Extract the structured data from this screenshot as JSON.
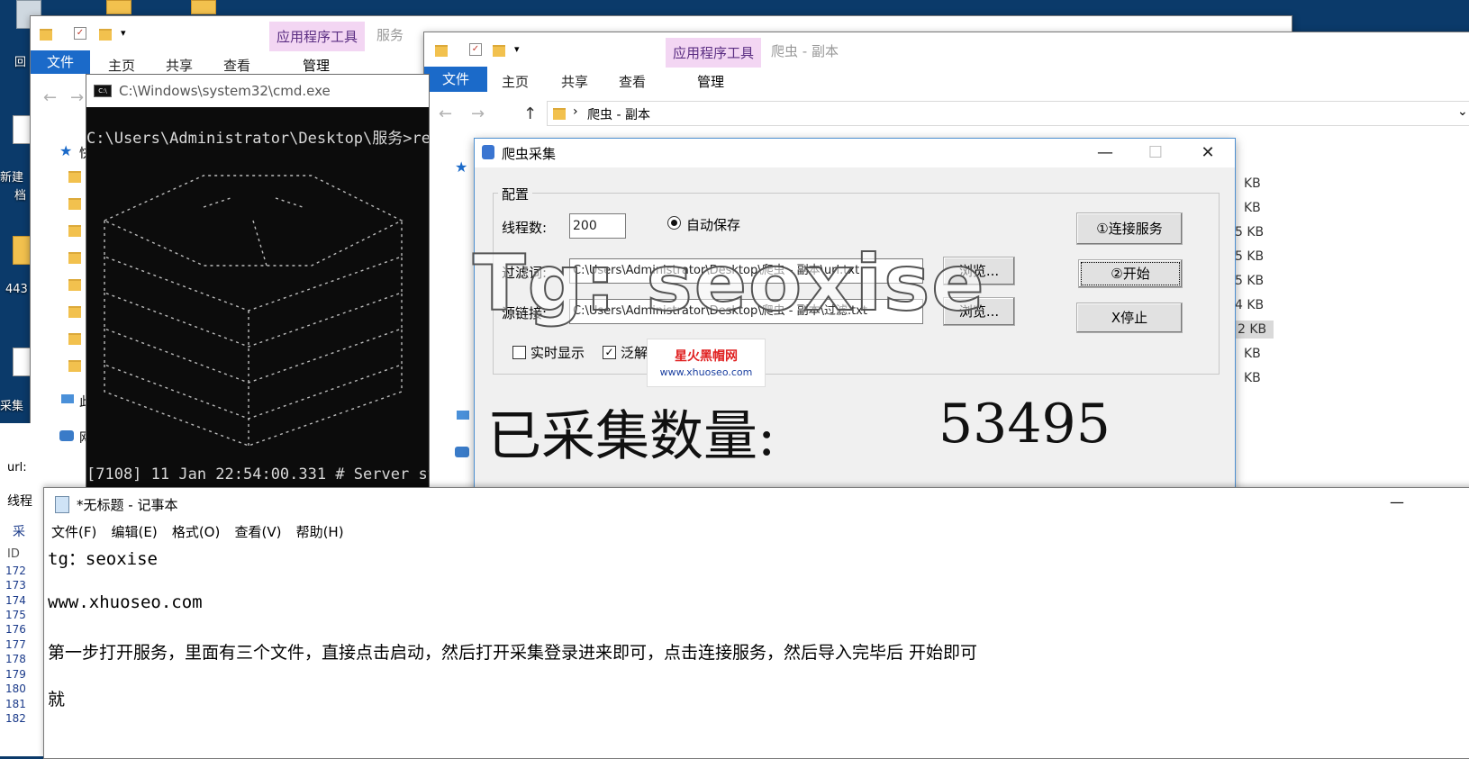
{
  "desktop": {
    "labels": [
      "回",
      "新建",
      "档",
      "443",
      "采集"
    ]
  },
  "explorer_back": {
    "title": "服务",
    "file_tab": "文件",
    "tabs": [
      "主页",
      "共享",
      "查看"
    ],
    "context_tab": "应用程序工具",
    "context_sub": "管理",
    "sidebar": [
      "快",
      "此",
      "网"
    ]
  },
  "explorer_front": {
    "title": "爬虫 - 副本",
    "file_tab": "文件",
    "tabs": [
      "主页",
      "共享",
      "查看"
    ],
    "context_tab": "应用程序工具",
    "context_sub": "管理",
    "address": "爬虫 - 副本",
    "sizes": [
      "KB",
      "KB",
      "5 KB",
      "5 KB",
      "5 KB",
      "4 KB",
      "2 KB",
      "KB",
      "KB"
    ]
  },
  "cmd": {
    "title": "C:\\Windows\\system32\\cmd.exe",
    "prompt": "C:\\Users\\Administrator\\Desktop\\服务>re",
    "log": "[7108] 11 Jan 22:54:00.331 # Server st"
  },
  "crawler": {
    "title": "爬虫采集",
    "group_label": "配置",
    "thread_label": "线程数:",
    "thread_value": "200",
    "auto_save_label": "自动保存",
    "filter_label": "过滤词:",
    "filter_path": "C:\\Users\\Administrator\\Desktop\\爬虫 - 副本\\url.txt",
    "source_label": "源链接:",
    "source_path": "C:\\Users\\Administrator\\Desktop\\爬虫 - 副本\\过滤.txt",
    "browse_label": "浏览...",
    "connect_button": "①连接服务",
    "start_button": "②开始",
    "stop_button": "X停止",
    "realtime_label": "实时显示",
    "parse_label": "泛解",
    "collected_label": "已采集数量:",
    "collected_value": "53495",
    "minimize": "—",
    "maximize": "☐",
    "close": "✕"
  },
  "watermark": "Tg: seoxise",
  "logo": {
    "name": "星火黑帽网",
    "url": "www.xhuoseo.com"
  },
  "notepad": {
    "title": "*无标题 - 记事本",
    "menu": [
      "文件(F)",
      "编辑(E)",
      "格式(O)",
      "查看(V)",
      "帮助(H)"
    ],
    "lines": [
      "tg：seoxise",
      "www.xhuoseo.com",
      "第一步打开服务，里面有三个文件，直接点击启动，然后打开采集登录进来即可，点击连接服务，然后导入完毕后  开始即可",
      "就"
    ]
  },
  "left_panel": {
    "url_label": "url:",
    "thread_label": "线程",
    "tab_label": "采",
    "id_header": "ID",
    "ids": [
      "172",
      "173",
      "174",
      "175",
      "176",
      "177",
      "178",
      "179",
      "180",
      "181",
      "182"
    ]
  },
  "colors": {
    "desktop": "#0b3a6a",
    "file_tab": "#1b6ac9",
    "context_tab": "#f3d6f3",
    "logo_red": "#e02020",
    "logo_blue": "#1a3fa0"
  }
}
